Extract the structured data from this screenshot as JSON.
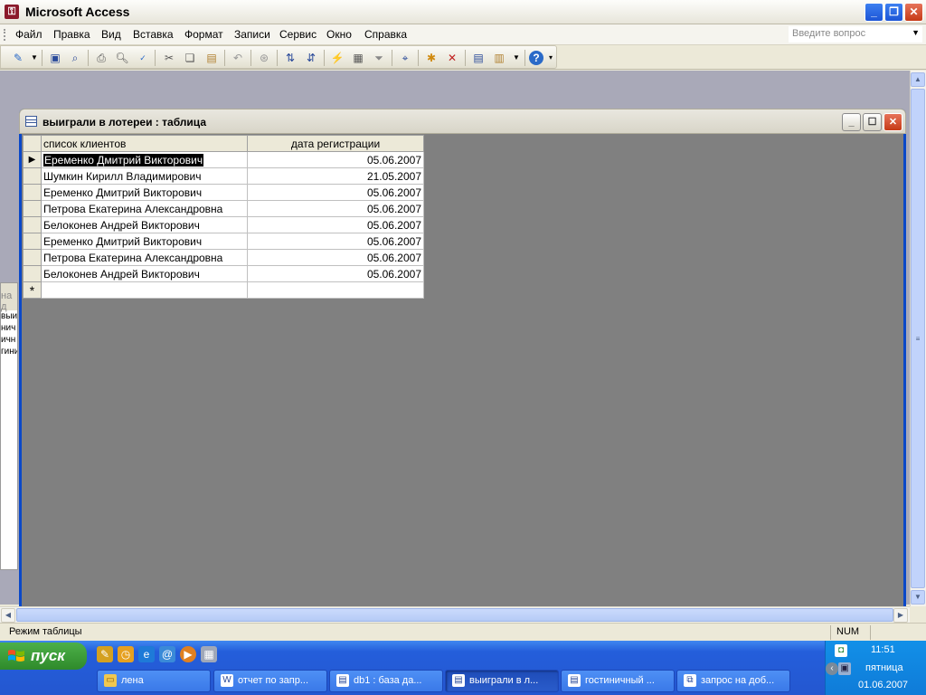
{
  "app": {
    "title": "Microsoft Access"
  },
  "menu": {
    "items": [
      "Файл",
      "Правка",
      "Вид",
      "Вставка",
      "Формат",
      "Записи",
      "Сервис",
      "Окно",
      "Справка"
    ],
    "ask_placeholder": "Введите вопрос"
  },
  "table_window": {
    "title": "выиграли в лотереи : таблица",
    "columns": [
      "список клиентов",
      "дата регистрации"
    ],
    "rows": [
      [
        "Еременко Дмитрий Викторович",
        "05.06.2007"
      ],
      [
        "Шумкин Кирилл Владимирович",
        "21.05.2007"
      ],
      [
        "Еременко Дмитрий Викторович",
        "05.06.2007"
      ],
      [
        "Петрова Екатерина Александровна",
        "05.06.2007"
      ],
      [
        "Белоконев Андрей Викторович",
        "05.06.2007"
      ],
      [
        "Еременко Дмитрий Викторович",
        "05.06.2007"
      ],
      [
        "Петрова Екатерина Александровна",
        "05.06.2007"
      ],
      [
        "Белоконев Андрей Викторович",
        "05.06.2007"
      ]
    ],
    "new_row_marker": "*",
    "current_row_marker": "▶"
  },
  "bg_window": {
    "header_fragment": "на д",
    "lines": [
      "выи",
      "нич",
      "ичн",
      "гини"
    ]
  },
  "status": {
    "mode": "Режим таблицы",
    "num": "NUM"
  },
  "taskbar": {
    "start_label": "пуск",
    "tasks": [
      "лена",
      "отчет по запр...",
      "db1 : база да...",
      "выиграли в л...",
      "гостиничный ...",
      "запрос на доб..."
    ],
    "active_task": 3,
    "clock": {
      "time": "11:51",
      "day": "пятница",
      "date": "01.06.2007"
    }
  },
  "colors": {
    "accent": "#245EDB",
    "mdi_background": "#A9A9B8",
    "datasheet_empty": "#808080",
    "start_green": "#3C9B38"
  }
}
